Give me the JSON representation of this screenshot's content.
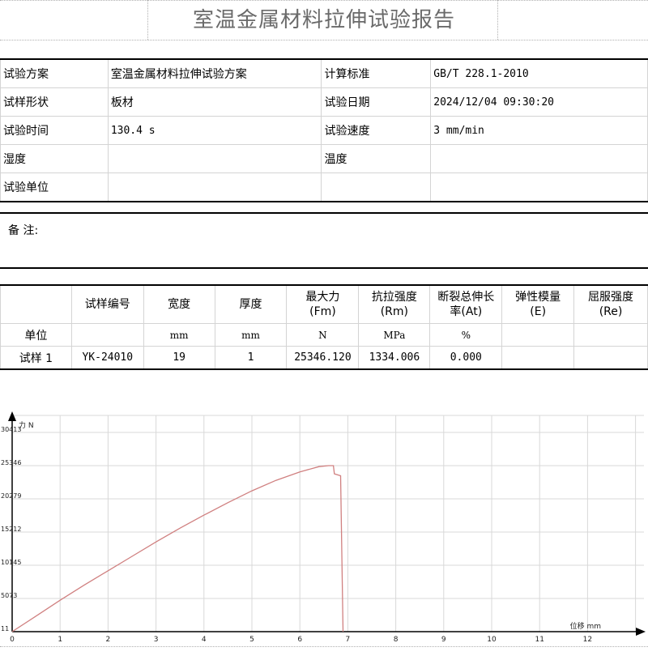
{
  "report": {
    "title": "室温金属材料拉伸试验报告"
  },
  "info": {
    "rows": [
      {
        "label1": "试验方案",
        "value1": "室温金属材料拉伸试验方案",
        "label2": "计算标准",
        "value2": "GB/T 228.1-2010"
      },
      {
        "label1": "试样形状",
        "value1": "板材",
        "label2": "试验日期",
        "value2": "2024/12/04 09:30:20"
      },
      {
        "label1": "试验时间",
        "value1": "130.4 s",
        "label2": "试验速度",
        "value2": "3 mm/min"
      },
      {
        "label1": "湿度",
        "value1": "",
        "label2": "温度",
        "value2": ""
      },
      {
        "label1": "试验单位",
        "value1": "",
        "label2": "",
        "value2": ""
      }
    ]
  },
  "remark": {
    "label": "备 注:"
  },
  "results": {
    "headers": [
      {
        "l1": "",
        "l2": ""
      },
      {
        "l1": "试样编号",
        "l2": ""
      },
      {
        "l1": "宽度",
        "l2": ""
      },
      {
        "l1": "厚度",
        "l2": ""
      },
      {
        "l1": "最大力",
        "l2": "(Fm)"
      },
      {
        "l1": "抗拉强度",
        "l2": "(Rm)"
      },
      {
        "l1": "断裂总伸长",
        "l2": "率(At)"
      },
      {
        "l1": "弹性模量",
        "l2": "(E)"
      },
      {
        "l1": "屈服强度",
        "l2": "(Re)"
      }
    ],
    "units": [
      "单位",
      "",
      "mm",
      "mm",
      "N",
      "MPa",
      "%",
      "",
      ""
    ],
    "rows": [
      [
        "试样 1",
        "YK-24010",
        "19",
        "1",
        "25346.120",
        "1334.006",
        "0.000",
        "",
        ""
      ]
    ]
  },
  "chart_data": {
    "type": "line",
    "ylabel": "力 N",
    "xlabel": "位移 mm",
    "xlim": [
      0,
      13
    ],
    "ylim": [
      11,
      30413
    ],
    "x_ticks": [
      "0",
      "1",
      "2",
      "3",
      "4",
      "5",
      "6",
      "7",
      "8",
      "9",
      "10",
      "11",
      "12"
    ],
    "y_ticks": [
      "11",
      "5073",
      "10145",
      "15212",
      "20279",
      "25346",
      "30413"
    ],
    "grid": true,
    "series": [
      {
        "color": "#d08080",
        "points": [
          [
            0.0,
            11
          ],
          [
            0.5,
            2400
          ],
          [
            1.0,
            4800
          ],
          [
            1.5,
            7100
          ],
          [
            2.0,
            9300
          ],
          [
            2.5,
            11500
          ],
          [
            3.0,
            13700
          ],
          [
            3.5,
            15800
          ],
          [
            4.0,
            17800
          ],
          [
            4.5,
            19700
          ],
          [
            5.0,
            21500
          ],
          [
            5.5,
            23100
          ],
          [
            6.0,
            24400
          ],
          [
            6.4,
            25200
          ],
          [
            6.6,
            25346
          ],
          [
            6.7,
            25346
          ],
          [
            6.72,
            24100
          ],
          [
            6.85,
            23800
          ],
          [
            6.9,
            11
          ]
        ]
      }
    ]
  }
}
